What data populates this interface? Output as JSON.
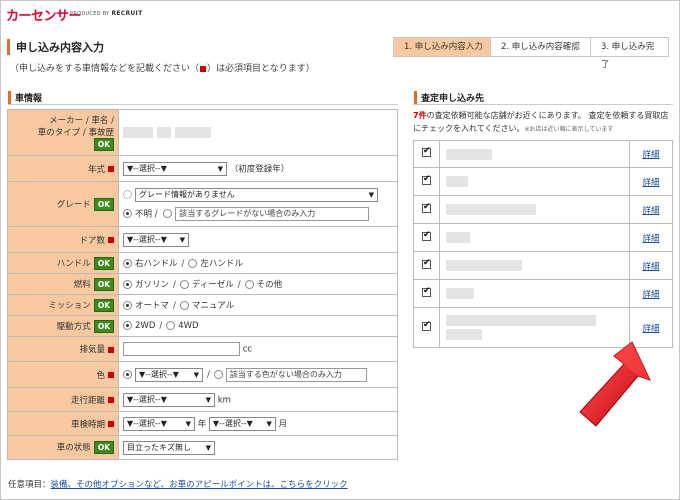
{
  "header": {
    "logo": "カーセンサー",
    "produced_by": "PRODUCED BY",
    "producer": "RECRUIT"
  },
  "page": {
    "title": "申し込み内容入力",
    "subtitle_pre": "（申し込みをする車情報などを記載ください（",
    "subtitle_post": "）は必須項目となります）"
  },
  "steps": [
    {
      "label": "1. 申し込み内容入力"
    },
    {
      "label": "2. 申し込み内容確認"
    },
    {
      "label": "3. 申し込み完了"
    }
  ],
  "vehicle_section": {
    "title": "車情報",
    "rows": {
      "maker": {
        "label_line1": "メーカー / 車名 /",
        "label_line2": "車のタイプ / 事故歴",
        "badge": "OK"
      },
      "year": {
        "label": "年式",
        "select": "▼--選択--▼",
        "note": "（初度登録年）"
      },
      "grade": {
        "label": "グレード",
        "badge": "OK",
        "select": "グレード情報がありません",
        "opt_unknown": "不明 /",
        "placeholder": "該当するグレードがない場合のみ入力"
      },
      "doors": {
        "label": "ドア数",
        "select": "▼--選択--▼"
      },
      "handle": {
        "label": "ハンドル",
        "badge": "OK",
        "opt1": "右ハンドル",
        "opt2": "左ハンドル"
      },
      "fuel": {
        "label": "燃料",
        "badge": "OK",
        "opt1": "ガソリン",
        "opt2": "ディーゼル",
        "opt3": "その他"
      },
      "mission": {
        "label": "ミッション",
        "badge": "OK",
        "opt1": "オートマ",
        "opt2": "マニュアル"
      },
      "drive": {
        "label": "駆動方式",
        "badge": "OK",
        "opt1": "2WD",
        "opt2": "4WD"
      },
      "displacement": {
        "label": "排気量",
        "unit": "cc"
      },
      "color": {
        "label": "色",
        "select": "▼--選択--▼",
        "placeholder": "該当する色がない場合のみ入力"
      },
      "mileage": {
        "label": "走行距離",
        "select": "▼--選択--▼",
        "unit": "km"
      },
      "inspection": {
        "label": "車検時期",
        "select_year": "▼--選択--▼",
        "unit_year": "年",
        "select_month": "▼--選択--▼",
        "unit_month": "月"
      },
      "condition": {
        "label": "車の状態",
        "badge": "OK",
        "select": "目立ったキズ無し"
      }
    }
  },
  "footer": {
    "prefix": "任意項目：",
    "link": "装備、その他オプションなど、お車のアピールポイントは、こちらをクリック"
  },
  "assessment": {
    "title": "査定申し込み先",
    "count": "7件",
    "note": "の査定依頼可能な店舗がお近くにあります。 査定を依頼する買取店にチェックを入れてください。",
    "small": "※お店は近い順に表示しています",
    "detail_label": "詳細"
  },
  "colors": {
    "label_bg": "#f8c9a0",
    "ok_green": "#3e8a1c",
    "required_red": "#cc0000",
    "accent_orange": "#e06d2c",
    "link_blue": "#1a4fa0",
    "arrow_red": "#e8141c"
  }
}
